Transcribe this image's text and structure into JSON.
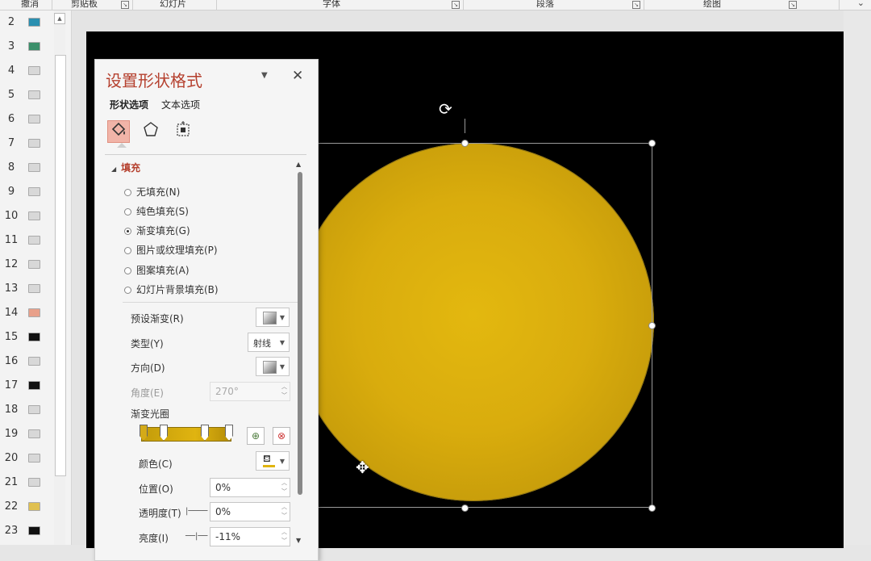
{
  "ribbon": {
    "groups": [
      "撤消",
      "剪贴板",
      "幻灯片",
      "字体",
      "段落",
      "绘图"
    ]
  },
  "thumbnails": {
    "numbers": [
      "2",
      "3",
      "4",
      "5",
      "6",
      "7",
      "8",
      "9",
      "10",
      "11",
      "12",
      "13",
      "14",
      "15",
      "16",
      "17",
      "18",
      "19",
      "20",
      "21",
      "22",
      "23"
    ]
  },
  "pane": {
    "title": "设置形状格式",
    "tabs": [
      "形状选项",
      "文本选项"
    ],
    "section": "填充",
    "fill_options": [
      "无填充(N)",
      "纯色填充(S)",
      "渐变填充(G)",
      "图片或纹理填充(P)",
      "图案填充(A)",
      "幻灯片背景填充(B)"
    ],
    "selected_fill": "渐变填充(G)",
    "preset_label": "预设渐变(R)",
    "type_label": "类型(Y)",
    "type_value": "射线",
    "direction_label": "方向(D)",
    "angle_label": "角度(E)",
    "angle_value": "270°",
    "stops_label": "渐变光圈",
    "color_label": "颜色(C)",
    "position_label": "位置(O)",
    "position_value": "0%",
    "transparency_label": "透明度(T)",
    "transparency_value": "0%",
    "brightness_label": "亮度(I)",
    "brightness_value": "-11%"
  },
  "colors": {
    "accent": "#b5402e",
    "shape_fill": "#e0b410",
    "slide_bg": "#000000"
  },
  "icons": {
    "fill_line": "paint-bucket-icon",
    "effects": "pentagon-icon",
    "size_props": "size-position-icon"
  }
}
